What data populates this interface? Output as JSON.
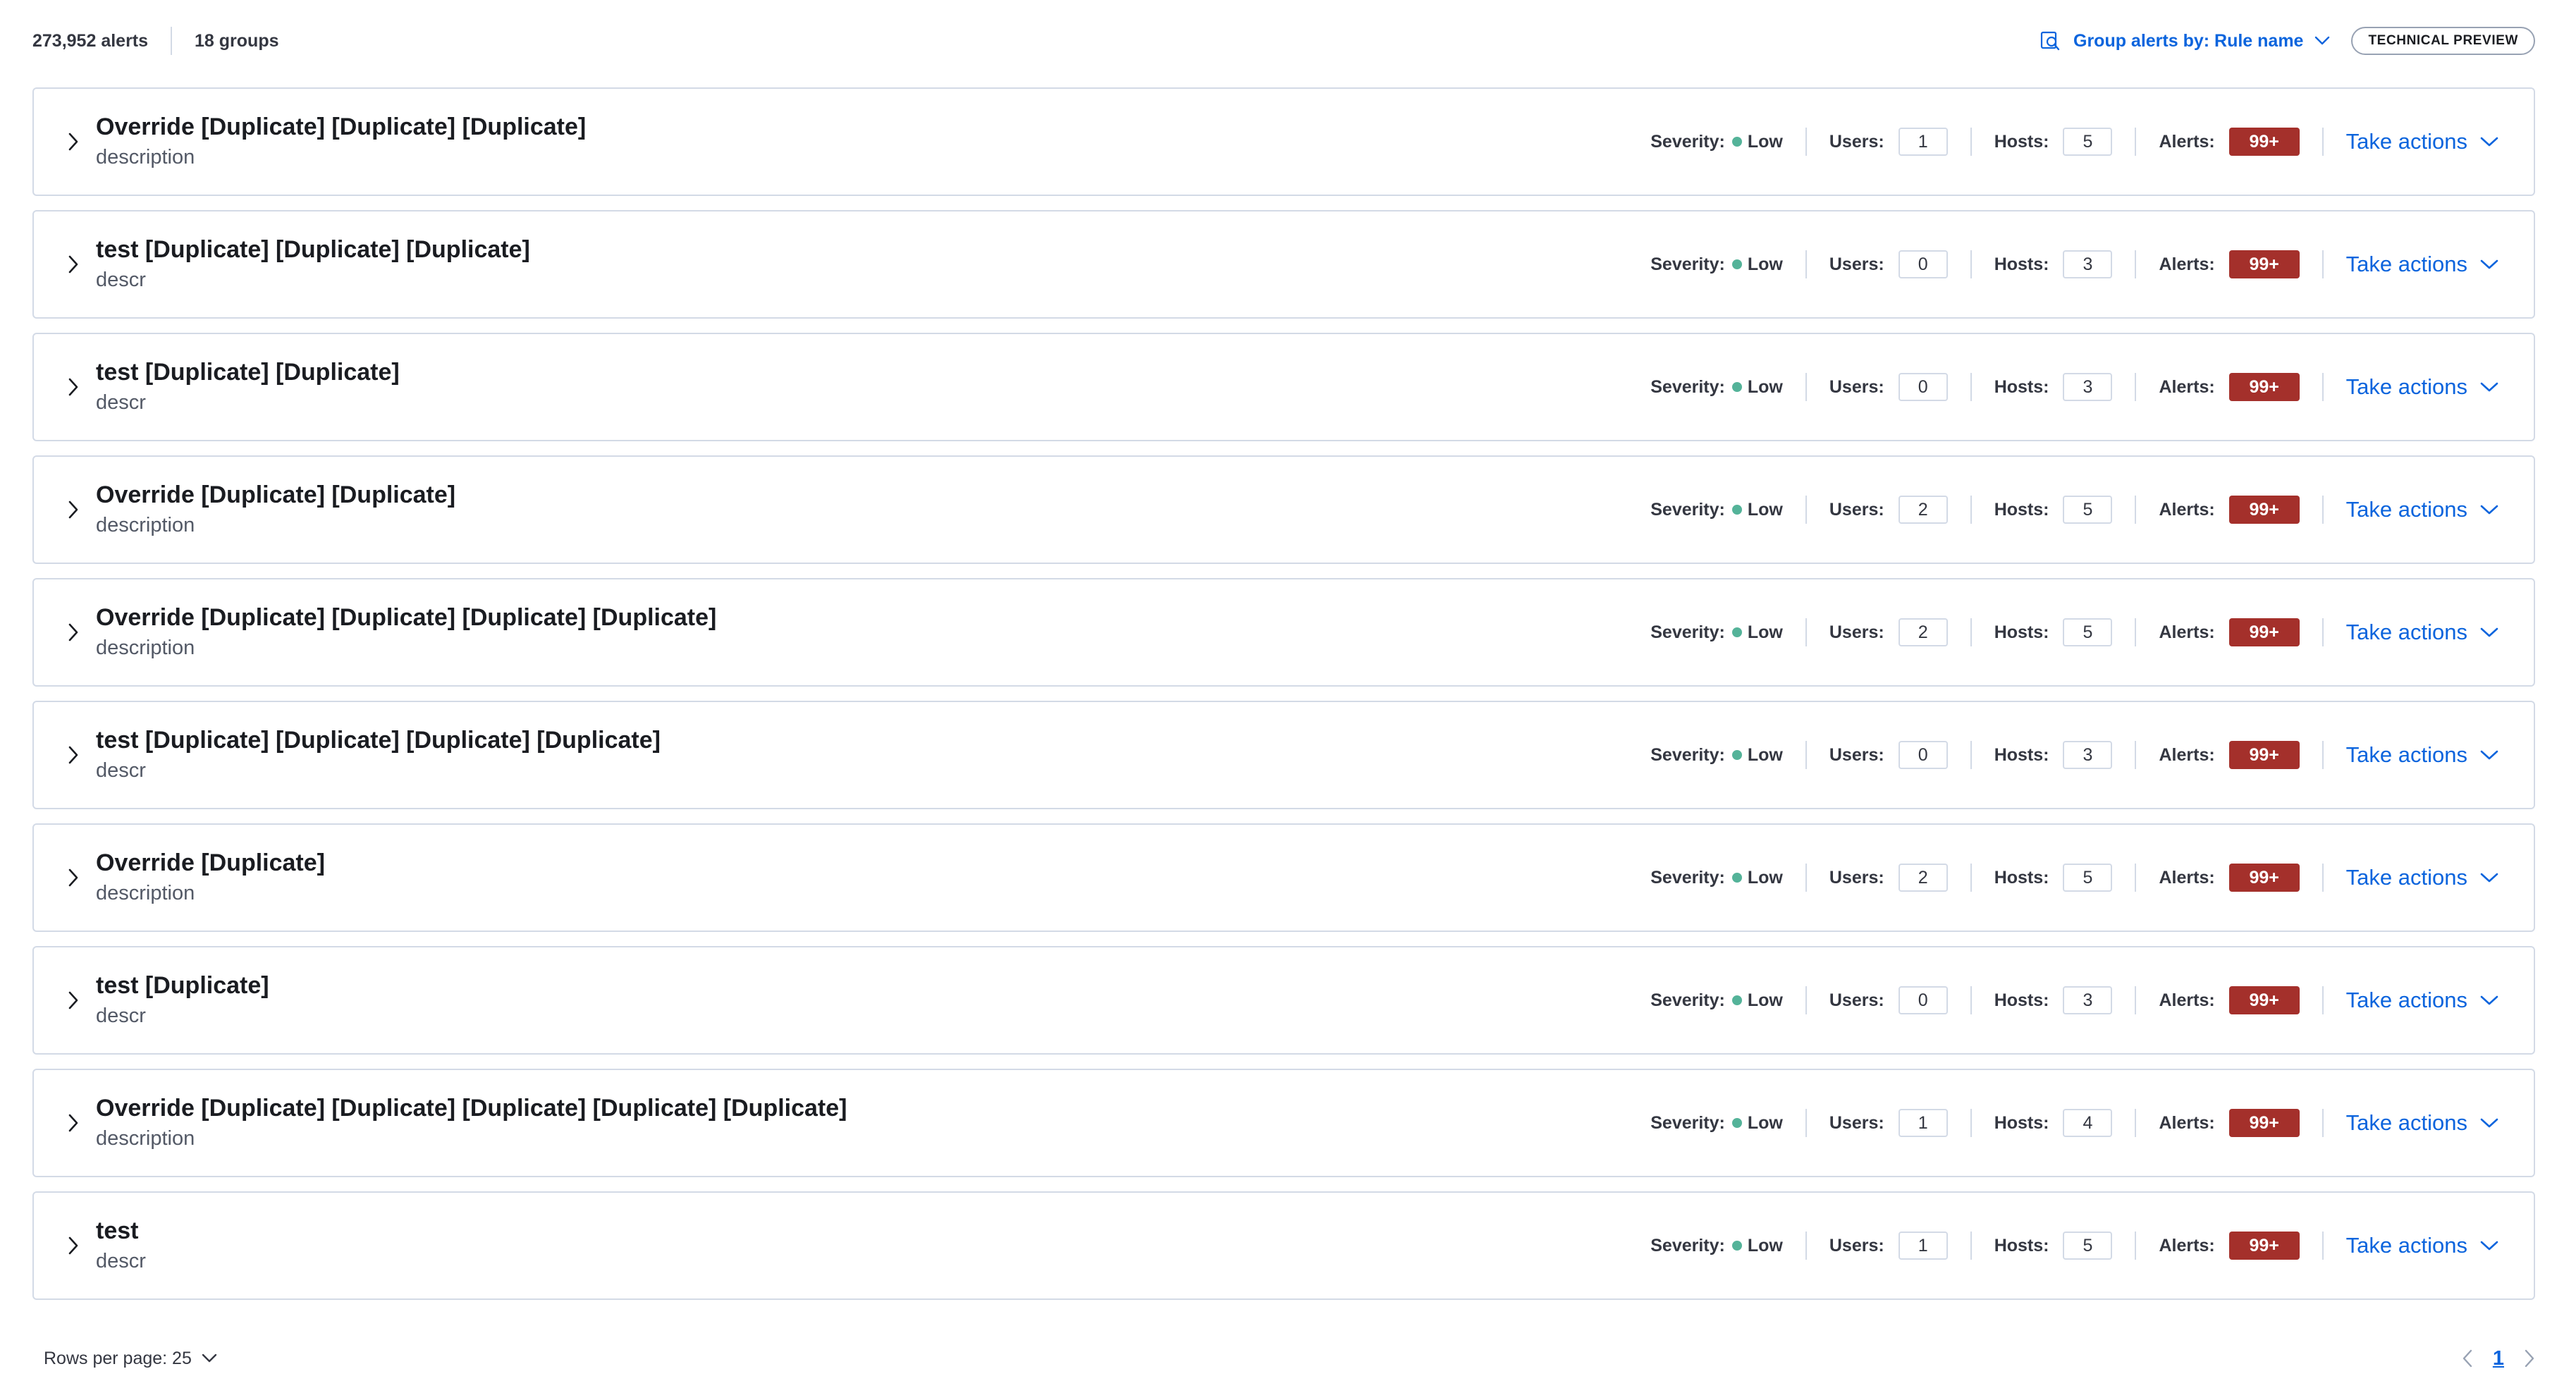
{
  "header": {
    "alerts_count": "273,952 alerts",
    "groups_count": "18 groups",
    "group_by_label": "Group alerts by: Rule name",
    "badge": "TECHNICAL PREVIEW"
  },
  "labels": {
    "severity": "Severity:",
    "users": "Users:",
    "hosts": "Hosts:",
    "alerts": "Alerts:",
    "take_actions": "Take actions"
  },
  "groups": [
    {
      "title": "Override [Duplicate] [Duplicate] [Duplicate]",
      "description": "description",
      "severity": "Low",
      "users": "1",
      "hosts": "5",
      "alerts": "99+"
    },
    {
      "title": "test [Duplicate] [Duplicate] [Duplicate]",
      "description": "descr",
      "severity": "Low",
      "users": "0",
      "hosts": "3",
      "alerts": "99+"
    },
    {
      "title": "test [Duplicate] [Duplicate]",
      "description": "descr",
      "severity": "Low",
      "users": "0",
      "hosts": "3",
      "alerts": "99+"
    },
    {
      "title": "Override [Duplicate] [Duplicate]",
      "description": "description",
      "severity": "Low",
      "users": "2",
      "hosts": "5",
      "alerts": "99+"
    },
    {
      "title": "Override [Duplicate] [Duplicate] [Duplicate] [Duplicate]",
      "description": "description",
      "severity": "Low",
      "users": "2",
      "hosts": "5",
      "alerts": "99+"
    },
    {
      "title": "test [Duplicate] [Duplicate] [Duplicate] [Duplicate]",
      "description": "descr",
      "severity": "Low",
      "users": "0",
      "hosts": "3",
      "alerts": "99+"
    },
    {
      "title": "Override [Duplicate]",
      "description": "description",
      "severity": "Low",
      "users": "2",
      "hosts": "5",
      "alerts": "99+"
    },
    {
      "title": "test [Duplicate]",
      "description": "descr",
      "severity": "Low",
      "users": "0",
      "hosts": "3",
      "alerts": "99+"
    },
    {
      "title": "Override [Duplicate] [Duplicate] [Duplicate] [Duplicate] [Duplicate]",
      "description": "description",
      "severity": "Low",
      "users": "1",
      "hosts": "4",
      "alerts": "99+"
    },
    {
      "title": "test",
      "description": "descr",
      "severity": "Low",
      "users": "1",
      "hosts": "5",
      "alerts": "99+"
    }
  ],
  "footer": {
    "rows_per_page": "Rows per page: 25",
    "current_page": "1"
  },
  "colors": {
    "accent": "#0b64dd",
    "alert_badge": "#a4302b",
    "severity_low": "#54b399",
    "border": "#d3dae6"
  },
  "icons": {
    "group_by": "group-by-icon",
    "expand": "chevron-right-icon",
    "dropdown": "chevron-down-icon",
    "prev": "chevron-left-icon",
    "next": "chevron-right-icon"
  }
}
